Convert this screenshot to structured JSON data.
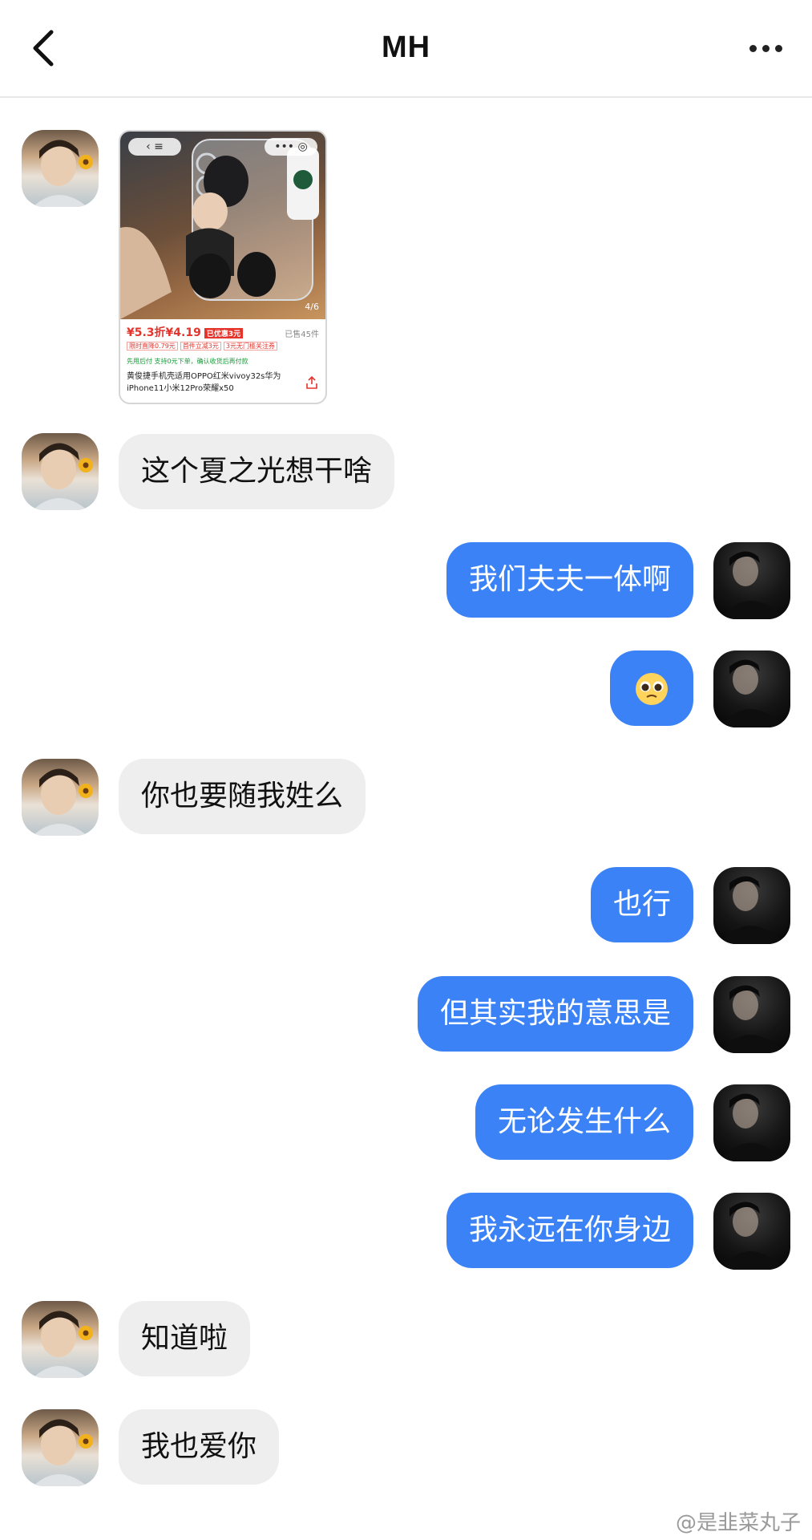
{
  "header": {
    "title": "MH"
  },
  "product_card": {
    "capsule_left": "‹ ≡",
    "capsule_right": "••• ◎",
    "page_indicator": "4/6",
    "price": "¥5.3折¥4.19",
    "price_tag": "已优惠3元",
    "sold": "已售45件",
    "coupons": [
      "限时直降0.79元",
      "首件立减3元",
      "3元无门槛关注券"
    ],
    "pay_note": "先用后付 支持0元下单，确认收货后再付款",
    "description": "黄俊捷手机壳适用OPPO红米vivoy32s华为iPhone11小米12Pro荣耀x50"
  },
  "messages": [
    {
      "side": "in",
      "text": "这个夏之光想干啥"
    },
    {
      "side": "out",
      "text": "我们夫夫一体啊"
    },
    {
      "side": "out",
      "text": "🥺"
    },
    {
      "side": "in",
      "text": "你也要随我姓么"
    },
    {
      "side": "out",
      "text": "也行"
    },
    {
      "side": "out",
      "text": "但其实我的意思是"
    },
    {
      "side": "out",
      "text": "无论发生什么"
    },
    {
      "side": "out",
      "text": "我永远在你身边"
    },
    {
      "side": "in",
      "text": "知道啦"
    },
    {
      "side": "in",
      "text": "我也爱你"
    }
  ],
  "watermark": "@是韭菜丸子",
  "colors": {
    "outgoing_bubble": "#3b82f6",
    "incoming_bubble": "#eeeeee"
  }
}
